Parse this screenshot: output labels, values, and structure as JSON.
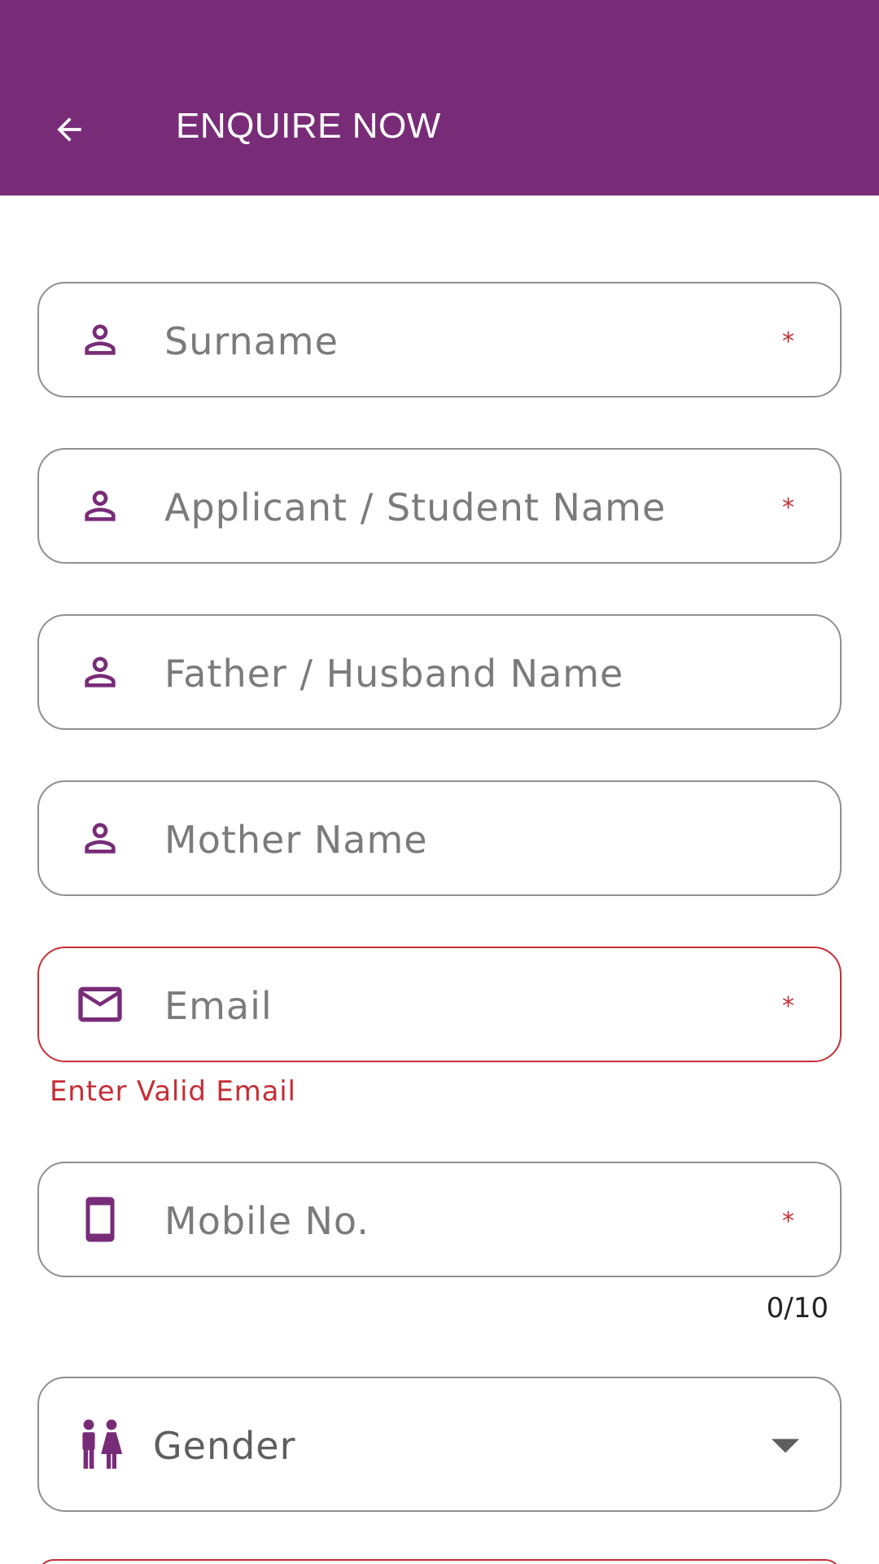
{
  "theme": {
    "brand": "#782c78",
    "error": "#c62e35",
    "border": "#8f8f8f"
  },
  "appbar": {
    "title": "ENQUIRE NOW",
    "back_icon": "arrow-back-icon"
  },
  "form": {
    "surname": {
      "placeholder": "Surname",
      "required_mark": "*",
      "icon": "person-icon"
    },
    "applicant": {
      "placeholder": "Applicant / Student Name",
      "required_mark": "*",
      "icon": "person-icon"
    },
    "father": {
      "placeholder": "Father / Husband Name",
      "icon": "person-icon"
    },
    "mother": {
      "placeholder": "Mother Name",
      "icon": "person-icon"
    },
    "email": {
      "placeholder": "Email",
      "required_mark": "*",
      "icon": "mail-icon",
      "error": "Enter Valid Email"
    },
    "mobile": {
      "placeholder": "Mobile No.",
      "required_mark": "*",
      "icon": "phone-icon",
      "counter": "0/10"
    },
    "gender": {
      "placeholder": "Gender",
      "icon": "gender-icon"
    }
  }
}
